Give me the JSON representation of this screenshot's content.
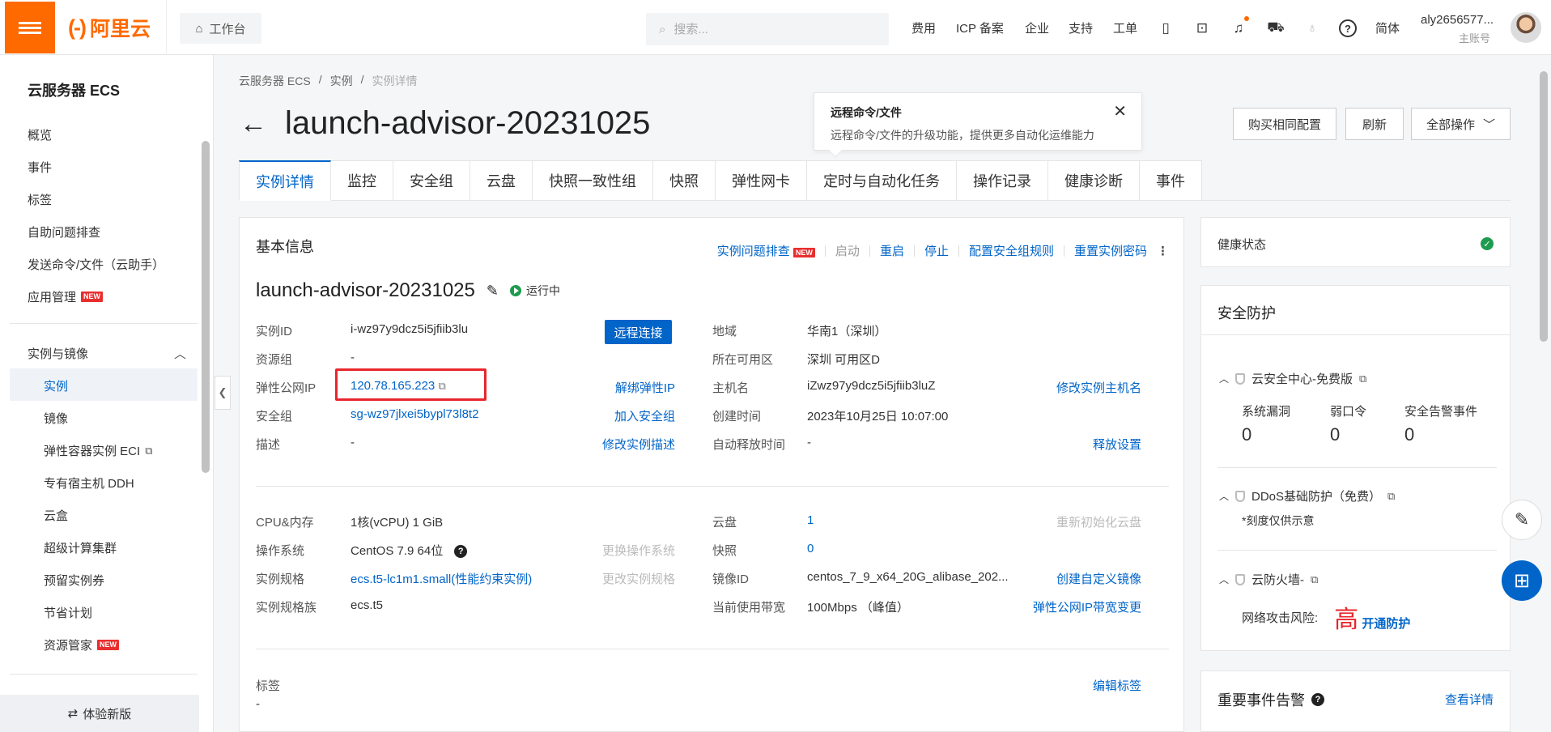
{
  "topbar": {
    "logo": "阿里云",
    "workbench": "工作台",
    "search_placeholder": "搜索...",
    "nav": [
      "费用",
      "ICP 备案",
      "企业",
      "支持",
      "工单"
    ],
    "lang": "简体",
    "user_name": "aly2656577...",
    "user_role": "主账号"
  },
  "sidebar": {
    "title": "云服务器 ECS",
    "items": [
      "概览",
      "事件",
      "标签",
      "自助问题排查",
      "发送命令/文件（云助手）",
      "应用管理"
    ],
    "group": "实例与镜像",
    "subitems": [
      "实例",
      "镜像",
      "弹性容器实例 ECI",
      "专有宿主机 DDH",
      "云盒",
      "超级计算集群",
      "预留实例券",
      "节省计划",
      "资源管家"
    ],
    "new_badge": "NEW",
    "try_new": "体验新版"
  },
  "breadcrumb": [
    "云服务器 ECS",
    "实例",
    "实例详情"
  ],
  "page": {
    "title": "launch-advisor-20231025",
    "tip_title": "远程命令/文件",
    "tip_body": "远程命令/文件的升级功能，提供更多自动化运维能力",
    "btn_buy": "购买相同配置",
    "btn_refresh": "刷新",
    "btn_all": "全部操作"
  },
  "tabs": [
    "实例详情",
    "监控",
    "安全组",
    "云盘",
    "快照一致性组",
    "快照",
    "弹性网卡",
    "定时与自动化任务",
    "操作记录",
    "健康诊断",
    "事件"
  ],
  "basic": {
    "heading": "基本信息",
    "actions": {
      "troubleshoot": "实例问题排查",
      "start": "启动",
      "restart": "重启",
      "stop": "停止",
      "sg_rules": "配置安全组规则",
      "reset_pwd": "重置实例密码"
    },
    "instance_name": "launch-advisor-20231025",
    "status": "运行中",
    "remote_connect": "远程连接",
    "left_rows": [
      {
        "label": "实例ID",
        "value": "i-wz97y9dcz5i5jfiib3lu",
        "action": ""
      },
      {
        "label": "资源组",
        "value": "-",
        "action": ""
      },
      {
        "label": "弹性公网IP",
        "value": "120.78.165.223",
        "action": "解绑弹性IP"
      },
      {
        "label": "安全组",
        "value": "sg-wz97jlxei5bypl73l8t2",
        "action": "加入安全组"
      },
      {
        "label": "描述",
        "value": "-",
        "action": "修改实例描述"
      }
    ],
    "right_rows": [
      {
        "label": "地域",
        "value": "华南1（深圳）",
        "action": ""
      },
      {
        "label": "所在可用区",
        "value": "深圳 可用区D",
        "action": ""
      },
      {
        "label": "主机名",
        "value": "iZwz97y9dcz5i5jfiib3luZ",
        "action": "修改实例主机名"
      },
      {
        "label": "创建时间",
        "value": "2023年10月25日 10:07:00",
        "action": ""
      },
      {
        "label": "自动释放时间",
        "value": "-",
        "action": "释放设置"
      }
    ],
    "left_rows2": [
      {
        "label": "CPU&内存",
        "value": "1核(vCPU) 1 GiB",
        "action": ""
      },
      {
        "label": "操作系统",
        "value": "CentOS 7.9 64位",
        "action": "更换操作系统"
      },
      {
        "label": "实例规格",
        "value": "ecs.t5-lc1m1.small(性能约束实例)",
        "action": "更改实例规格"
      },
      {
        "label": "实例规格族",
        "value": "ecs.t5",
        "action": ""
      }
    ],
    "right_rows2": [
      {
        "label": "云盘",
        "value": "1",
        "action": "重新初始化云盘"
      },
      {
        "label": "快照",
        "value": "0",
        "action": ""
      },
      {
        "label": "镜像ID",
        "value": "centos_7_9_x64_20G_alibase_202...",
        "action": "创建自定义镜像"
      },
      {
        "label": "当前使用带宽",
        "value": "100Mbps （峰值）",
        "action": "弹性公网IP带宽变更"
      }
    ],
    "tags_label": "标签",
    "tags_value": "-",
    "tags_action": "编辑标签"
  },
  "health": {
    "title": "健康状态"
  },
  "security": {
    "title": "安全防护",
    "center": "云安全中心-免费版",
    "metrics": [
      {
        "label": "系统漏洞",
        "value": "0"
      },
      {
        "label": "弱口令",
        "value": "0"
      },
      {
        "label": "安全告警事件",
        "value": "0"
      }
    ],
    "ddos": "DDoS基础防护（免费）",
    "ddos_note": "*刻度仅供示意",
    "firewall": "云防火墙-",
    "risk_label": "网络攻击风险:",
    "risk_level": "高",
    "risk_action": "开通防护"
  },
  "events": {
    "title": "重要事件告警",
    "more": "查看详情"
  }
}
